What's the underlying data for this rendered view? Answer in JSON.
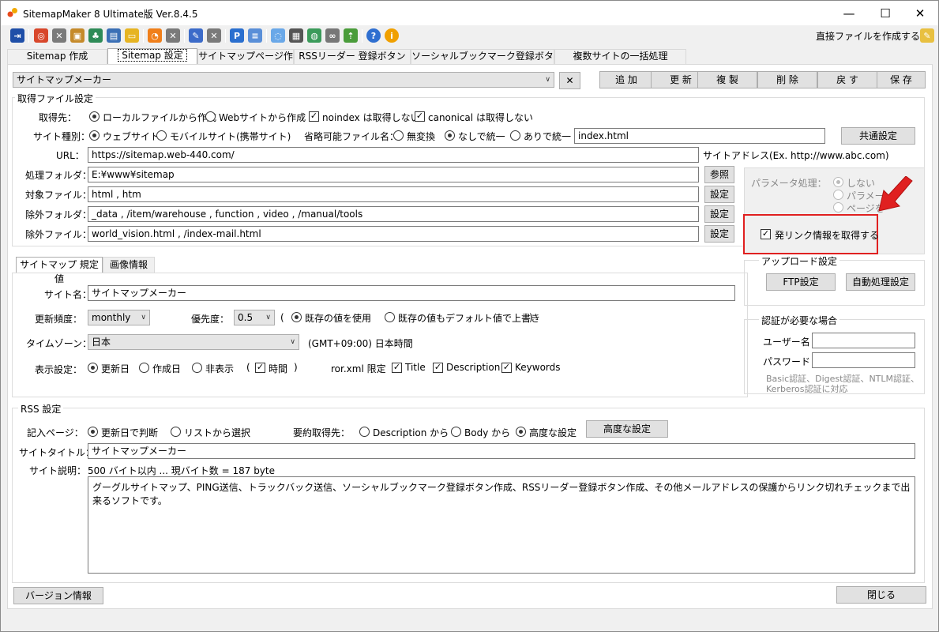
{
  "app": {
    "title": "SitemapMaker 8 Ultimate版  Ver.8.4.5",
    "minimize": "—",
    "maximize": "☐",
    "close": "✕",
    "toolbar_right_label": "直接ファイルを作成する ー"
  },
  "tabs": [
    "Sitemap 作成",
    "Sitemap 設定",
    "サイトマップページ作成",
    "RSSリーダー 登録ボタン作成",
    "ソーシャルブックマーク登録ボタン作成",
    "複数サイトの一括処理"
  ],
  "top": {
    "site_select": "サイトマップメーカー",
    "buttons": [
      "追 加",
      "更 新",
      "複 製",
      "削 除",
      "戻 す",
      "保 存"
    ]
  },
  "fetch": {
    "group_title": "取得ファイル設定",
    "source_label": "取得先：",
    "source_local": "ローカルファイルから作成",
    "source_web": "Webサイトから作成",
    "noindex": "noindex は取得しない",
    "canonical": "canonical は取得しない",
    "type_label": "サイト種別：",
    "type_web": "ウェブサイト",
    "type_mobile": "モバイルサイト(携帯サイト)",
    "omit_label": "省略可能ファイル名：",
    "omit_none": "無変換",
    "omit_without": "なしで統一",
    "omit_with": "ありで統一",
    "index_value": "index.html",
    "common_btn": "共通設定",
    "url_label": "URL：",
    "url_value": "https://sitemap.web-440.com/",
    "site_address_hint": "サイトアドレス(Ex. http://www.abc.com)",
    "folder_label": "処理フォルダ：",
    "folder_value": "E:¥www¥sitemap",
    "browse_btn": "参照",
    "target_label": "対象ファイル：",
    "target_value": "html , htm",
    "exclude_folder_label": "除外フォルダ：",
    "exclude_folder_value": "_data , /item/warehouse , function , video , /manual/tools",
    "exclude_file_label": "除外ファイル：",
    "exclude_file_value": "world_vision.html , /index-mail.html",
    "set_btn": "設定"
  },
  "param": {
    "label": "パラメータ処理：",
    "opt1": "しない",
    "opt2": "パラメー",
    "opt3": "ページを",
    "link_info": "発リンク情報を取得する"
  },
  "upload": {
    "title": "アップロード設定",
    "ftp": "FTP設定",
    "auto": "自動処理設定"
  },
  "auth": {
    "title": "認証が必要な場合",
    "user": "ユーザー名",
    "pass": "パスワード",
    "note": "Basic認証、Digest認証、NTLM認証、Kerberos認証に対応"
  },
  "sitemap": {
    "tab1": "サイトマップ 規定値",
    "tab2": "画像情報",
    "name_label": "サイト名：",
    "name_value": "サイトマップメーカー",
    "freq_label": "更新頻度：",
    "freq_value": "monthly",
    "prio_label": "優先度：",
    "prio_value": "0.5",
    "paren_open": "(",
    "paren_close": ")",
    "use_existing": "既存の値を使用",
    "overwrite": "既存の値もデフォルト値で上書き",
    "tz_label": "タイムゾーン：",
    "tz_value": "日本",
    "tz_desc": "(GMT+09:00) 日本時間",
    "disp_label": "表示設定：",
    "disp_updated": "更新日",
    "disp_created": "作成日",
    "disp_hidden": "非表示",
    "disp_time": "時間",
    "ror_label": "ror.xml 限定",
    "ror_title": "Title",
    "ror_desc": "Description",
    "ror_kw": "Keywords"
  },
  "rss": {
    "title": "RSS 設定",
    "page_label": "記入ページ：",
    "page_updated": "更新日で判断",
    "page_list": "リストから選択",
    "summary_label": "要約取得先：",
    "sum_desc": "Description から",
    "sum_body": "Body から",
    "sum_adv": "高度な設定",
    "adv_btn": "高度な設定",
    "site_title_label": "サイトタイトル：",
    "site_title_value": "サイトマップメーカー",
    "desc_label": "サイト説明：",
    "desc_count": "500 バイト以内 ...   現バイト数 = 187 byte",
    "desc_value": "グーグルサイトマップ、PING送信、トラックバック送信、ソーシャルブックマーク登録ボタン作成、RSSリーダー登録ボタン作成、その他メールアドレスの保護からリンク切れチェックまで出来るソフトです。"
  },
  "footer": {
    "version": "バージョン情報",
    "close": "閉じる"
  },
  "colors": {
    "highlight": "#e02020",
    "arrow": "#e02020"
  }
}
